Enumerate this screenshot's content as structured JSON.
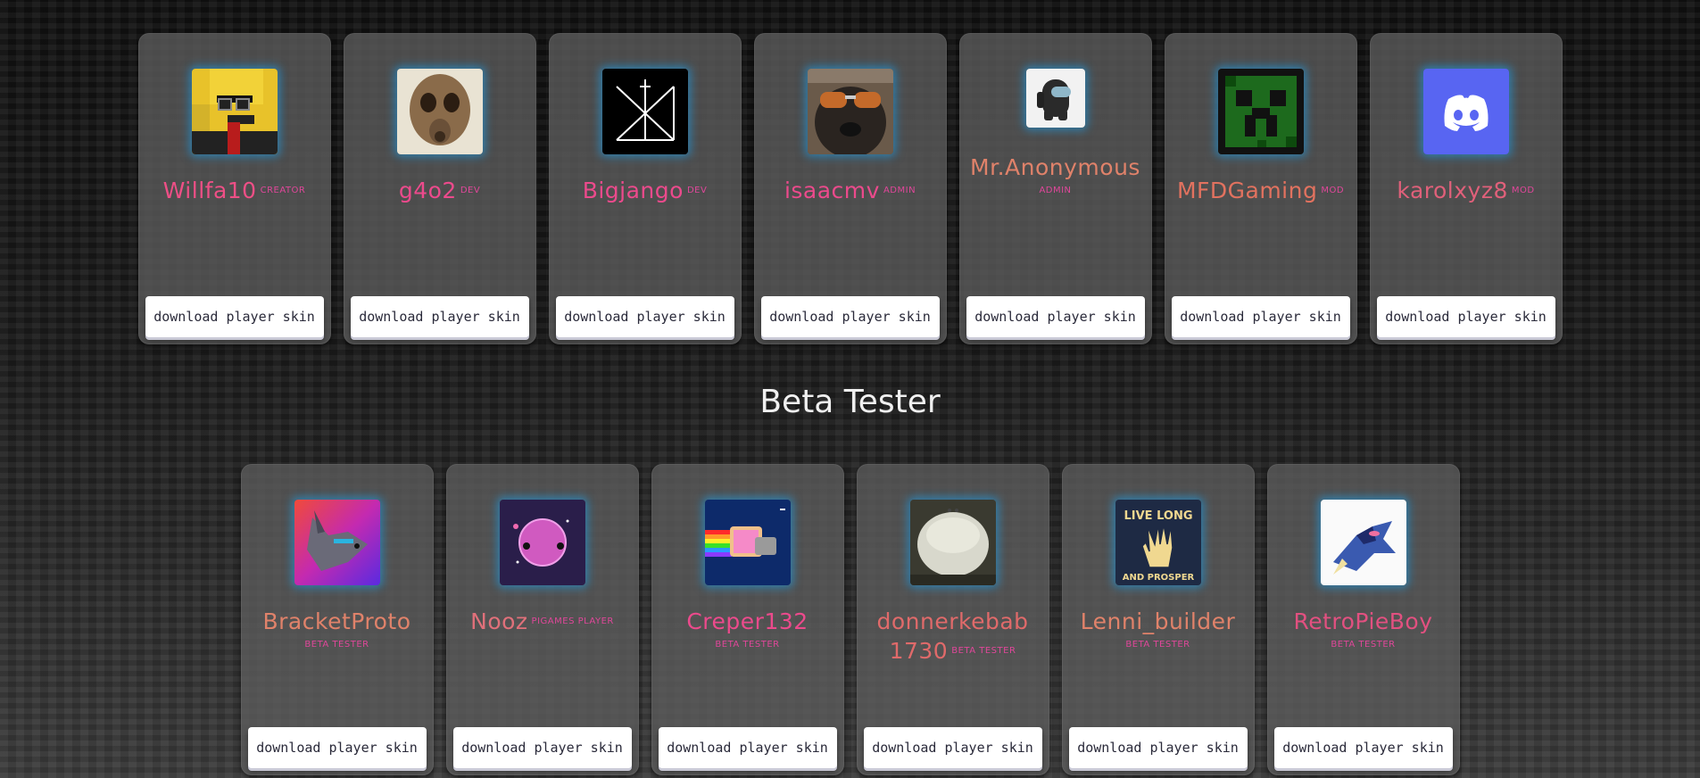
{
  "staff": [
    {
      "username": "Willfa10",
      "role": "CREATOR",
      "role_block": false,
      "name_color": "#ee4f86",
      "avatar": "yellow-pixel-character-avatar",
      "button": "download player skin"
    },
    {
      "username": "g4o2",
      "role": "DEV",
      "role_block": false,
      "name_color": "#ec4a8c",
      "avatar": "gas-mask-face-avatar",
      "button": "download player skin"
    },
    {
      "username": "Bigjango",
      "role": "DEV",
      "role_block": false,
      "name_color": "#ec4a8c",
      "avatar": "geometric-logo-avatar",
      "button": "download player skin"
    },
    {
      "username": "isaacmv",
      "role": "ADMIN",
      "role_block": false,
      "name_color": "#ec4a8c",
      "avatar": "dog-sunglasses-avatar",
      "button": "download player skin"
    },
    {
      "username": "Mr.Anonymous",
      "role": "ADMIN",
      "role_block": true,
      "name_color": "#e0826a",
      "avatar": "among-us-crewmate-avatar",
      "button": "download player skin"
    },
    {
      "username": "MFDGaming",
      "role": "MOD",
      "role_block": false,
      "name_color": "#e2725f",
      "avatar": "green-creeper-face-avatar",
      "button": "download player skin"
    },
    {
      "username": "karolxyz8",
      "role": "MOD",
      "role_block": false,
      "name_color": "#e0607a",
      "avatar": "discord-logo-avatar",
      "button": "download player skin"
    }
  ],
  "section_heading": "Beta Tester",
  "beta": [
    {
      "username": "BracketProto",
      "role": "BETA TESTER",
      "role_block": true,
      "name_color": "#e0826a",
      "avatar": "wolf-character-avatar",
      "button": "download player skin"
    },
    {
      "username": "Nooz",
      "role": "PIGAMES PLAYER",
      "role_block": false,
      "name_color": "#e0707a",
      "avatar": "pink-planet-avatar",
      "button": "download player skin"
    },
    {
      "username": "Creper132",
      "role": "BETA TESTER",
      "role_block": true,
      "name_color": "#ec4a8c",
      "avatar": "nyan-cat-avatar",
      "button": "download player skin"
    },
    {
      "username": "donnerkebab 1730",
      "role": "BETA TESTER",
      "role_block": false,
      "name_color": "#e06a6a",
      "avatar": "white-blob-avatar",
      "button": "download player skin"
    },
    {
      "username": "Lenni_builder",
      "role": "BETA TESTER",
      "role_block": true,
      "name_color": "#e0826a",
      "avatar": "live-long-and-prosper-avatar",
      "button": "download player skin"
    },
    {
      "username": "RetroPieBoy",
      "role": "BETA TESTER",
      "role_block": true,
      "name_color": "#e25080",
      "avatar": "greninja-avatar",
      "button": "download player skin"
    }
  ],
  "avatar_labels": {
    "creeper_text": "",
    "live_long": "LIVE LONG",
    "and_prosper": "AND PROSPER"
  }
}
